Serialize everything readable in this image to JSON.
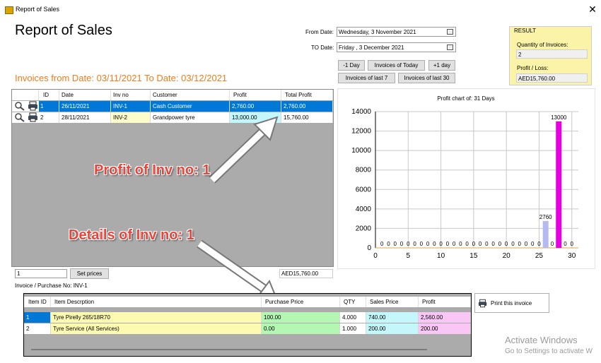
{
  "window": {
    "title": "Report of Sales",
    "close_glyph": "✕",
    "app_icon": "report-app-icon"
  },
  "page_title": "Report of Sales",
  "filters": {
    "from_label": "From Date:",
    "from_value": "Wednesday,  3 November 2021",
    "to_label": "TO Date:",
    "to_value": "Friday     ,  3 December 2021",
    "buttons": [
      "-1 Day",
      "Invoices of Today",
      "+1 day",
      "Invoices of last 7",
      "Invoices of last 30"
    ]
  },
  "result": {
    "title": "RESULT",
    "qty_label": "Quantity of Invoices:",
    "qty_value": "2",
    "profit_label": "Profit / Loss:",
    "profit_value": "AED15,760.00"
  },
  "range_text": "Invoices from Date: 03/11/2021  To Date: 03/12/2021",
  "invoices": {
    "columns": [
      "ID",
      "Date",
      "Inv no",
      "Customer",
      "Profit",
      "Total Profit"
    ],
    "rows": [
      {
        "id": "1",
        "date": "26/11/2021",
        "inv": "INV-1",
        "customer": "Cash Customer",
        "profit": "2,760.00",
        "total": "2,760.00"
      },
      {
        "id": "2",
        "date": "28/11/2021",
        "inv": "INV-2",
        "customer": "Grandpower tyre",
        "profit": "13,000.00",
        "total": "15,760.00"
      }
    ]
  },
  "below_grid": {
    "input_value": "1",
    "set_prices": "Set prices",
    "total": "AED15,760.00"
  },
  "invoice_no_label": "Invoice / Purchase No: INV-1",
  "annotations": {
    "profit": "Profit of Inv no: 1",
    "details": "Details of Inv no: 1"
  },
  "details": {
    "columns": [
      "Item ID",
      "Item Descrption",
      "Purchase Price",
      "QTY",
      "Sales Price",
      "Profit"
    ],
    "rows": [
      {
        "id": "1",
        "desc": "Tyre Pirelly 265/18R70",
        "purchase": "100.00",
        "qty": "4.000",
        "sales": "740.00",
        "profit": "2,560.00"
      },
      {
        "id": "2",
        "desc": "Tyre Service (All Services)",
        "purchase": "0.00",
        "qty": "1.000",
        "sales": "200.00",
        "profit": "200.00"
      }
    ]
  },
  "print_button": "Print this invoice",
  "watermark": {
    "line1": "Activate Windows",
    "line2": "Go to Settings to activate W"
  },
  "colors": {
    "selected_row": "#0078d7",
    "accent_orange": "#f07c1c",
    "bar_day26": "#b4b9f2",
    "bar_day28": "#e600e0",
    "result_bg": "#fbf4a8"
  },
  "chart_data": {
    "type": "bar",
    "title": "Profit chart of: 31 Days",
    "x": [
      1,
      2,
      3,
      4,
      5,
      6,
      7,
      8,
      9,
      10,
      11,
      12,
      13,
      14,
      15,
      16,
      17,
      18,
      19,
      20,
      21,
      22,
      23,
      24,
      25,
      26,
      27,
      28,
      29,
      30
    ],
    "values": [
      0,
      0,
      0,
      0,
      0,
      0,
      0,
      0,
      0,
      0,
      0,
      0,
      0,
      0,
      0,
      0,
      0,
      0,
      0,
      0,
      0,
      0,
      0,
      0,
      0,
      2760,
      0,
      13000,
      0,
      0
    ],
    "xlim": [
      0,
      31
    ],
    "ylim": [
      0,
      14000
    ],
    "xticks": [
      0,
      5,
      10,
      15,
      20,
      25,
      30
    ],
    "yticks": [
      0,
      2000,
      4000,
      6000,
      8000,
      10000,
      12000,
      14000
    ],
    "grid": true
  }
}
